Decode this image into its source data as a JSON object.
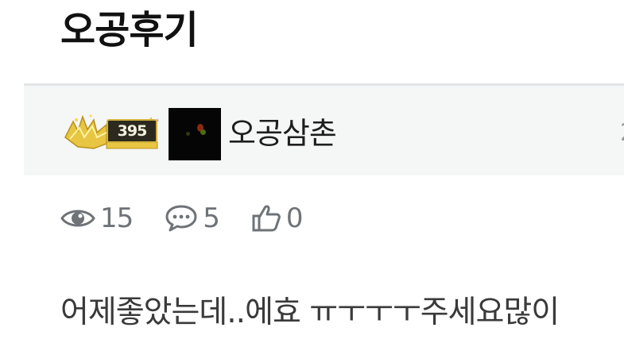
{
  "post": {
    "title": "오공후기",
    "body": "어제좋았는데..에효 ㅠㅜㅜㅜ주세요많이"
  },
  "author": {
    "level": "395",
    "name": "오공삼촌",
    "meta_partial": "2"
  },
  "stats": {
    "views": "15",
    "comments": "5",
    "likes": "0"
  },
  "colors": {
    "author_bar_bg": "#f5f6f6",
    "stat_text": "#6f7378",
    "badge_gold": "#d4b23c"
  }
}
